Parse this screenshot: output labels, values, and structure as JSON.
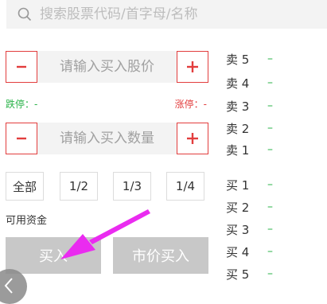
{
  "search": {
    "placeholder": "搜索股票代码/首字母/名称"
  },
  "price_stepper": {
    "placeholder": "请输入买入股价",
    "minus": "−",
    "plus": "+"
  },
  "limits": {
    "down_label": "跌停：-",
    "up_label": "涨停：-"
  },
  "qty_stepper": {
    "placeholder": "请输入买入数量",
    "minus": "−",
    "plus": "+"
  },
  "fractions": [
    "全部",
    "1/2",
    "1/3",
    "1/4"
  ],
  "funds_label": "可用资金",
  "actions": {
    "buy": "买入",
    "market_buy": "市价买入"
  },
  "orderbook": {
    "sell": [
      {
        "label": "卖 5",
        "value": "–"
      },
      {
        "label": "卖 4",
        "value": "–"
      },
      {
        "label": "卖 3",
        "value": "–"
      },
      {
        "label": "卖 2",
        "value": "–"
      },
      {
        "label": "卖 1",
        "value": "–"
      }
    ],
    "buy": [
      {
        "label": "买 1",
        "value": "–"
      },
      {
        "label": "买 2",
        "value": "–"
      },
      {
        "label": "买 3",
        "value": "–"
      },
      {
        "label": "买 4",
        "value": "–"
      },
      {
        "label": "买 5",
        "value": "–"
      }
    ]
  },
  "colors": {
    "accent_red": "#e23d3d",
    "green": "#2bb34a",
    "annotation": "#ea2bf0"
  }
}
